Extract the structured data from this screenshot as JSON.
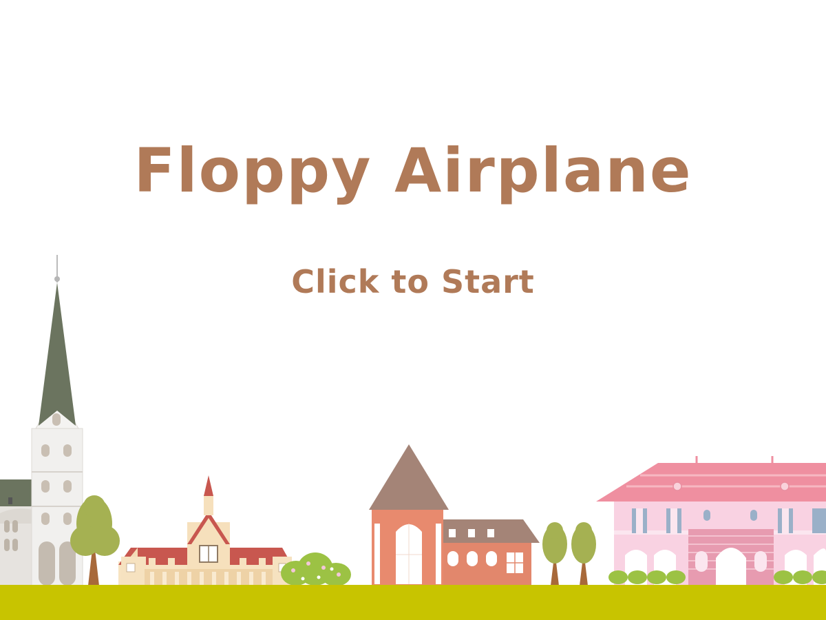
{
  "game": {
    "title": "Floppy Airplane",
    "start_prompt": "Click to Start"
  },
  "colors": {
    "text": "#b07a58",
    "background": "#ffffff",
    "ground": "#c8c400"
  },
  "scenery": [
    "church-with-spire",
    "cream-town-hall",
    "flower-bush",
    "brown-tower-house",
    "twin-trees",
    "pink-mansion"
  ]
}
